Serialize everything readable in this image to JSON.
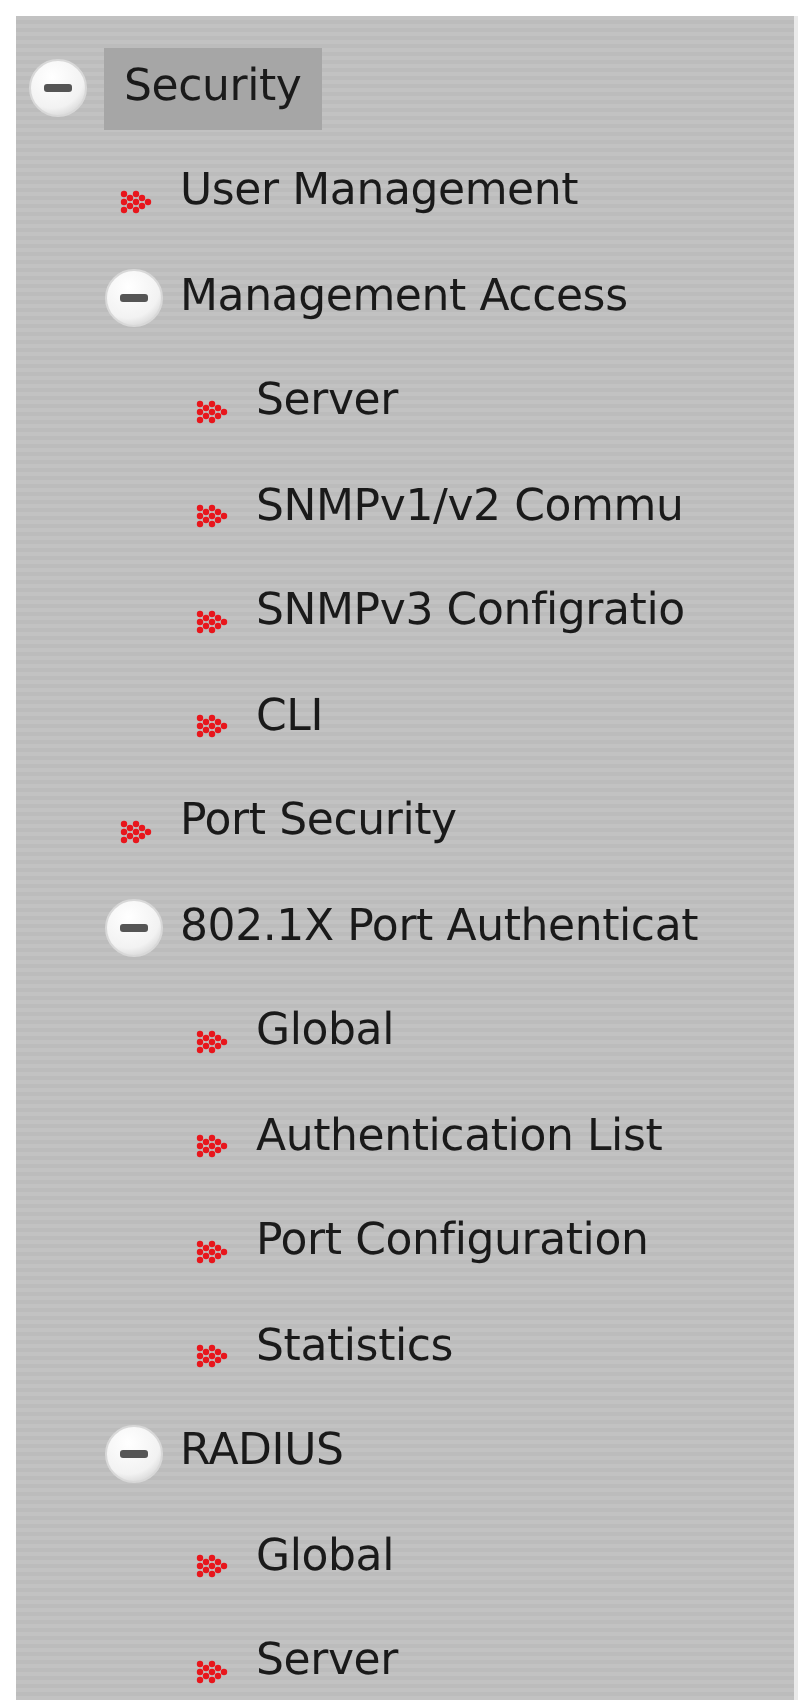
{
  "tree": [
    {
      "label": "Security",
      "selected": true,
      "expanded": true,
      "children": [
        {
          "label": "User Management",
          "selected": false
        },
        {
          "label": "Management Access",
          "selected": false,
          "expanded": true,
          "children": [
            {
              "label": "Server",
              "selected": false
            },
            {
              "label": "SNMPv1/v2 Commu",
              "selected": false
            },
            {
              "label": "SNMPv3 Configratio",
              "selected": false
            },
            {
              "label": "CLI",
              "selected": false
            }
          ]
        },
        {
          "label": "Port Security",
          "selected": false
        },
        {
          "label": "802.1X Port Authenticat",
          "selected": false,
          "expanded": true,
          "children": [
            {
              "label": "Global",
              "selected": false
            },
            {
              "label": "Authentication List",
              "selected": false
            },
            {
              "label": "Port Configuration",
              "selected": false
            },
            {
              "label": "Statistics",
              "selected": false
            }
          ]
        },
        {
          "label": "RADIUS",
          "selected": false,
          "expanded": true,
          "children": [
            {
              "label": "Global",
              "selected": false
            },
            {
              "label": "Server",
              "selected": false
            }
          ]
        }
      ]
    }
  ]
}
